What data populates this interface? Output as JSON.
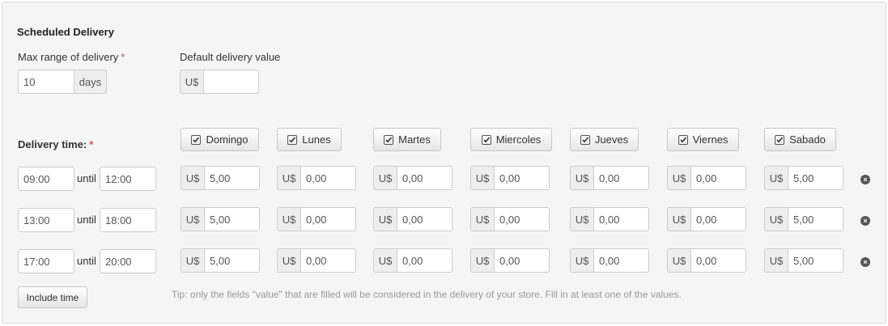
{
  "section_title": "Scheduled Delivery",
  "max_range": {
    "label": "Max range of delivery",
    "required": "*",
    "value": "10",
    "unit": "days"
  },
  "default_value": {
    "label": "Default delivery value",
    "currency": "U$",
    "value": ""
  },
  "delivery_time": {
    "label": "Delivery time:",
    "required": "*"
  },
  "days": [
    "Domingo",
    "Lunes",
    "Martes",
    "Miercoles",
    "Jueves",
    "Viernes",
    "Sabado"
  ],
  "currency": "U$",
  "until_label": "until",
  "rows": [
    {
      "from": "09:00",
      "to": "12:00",
      "values": [
        "5,00",
        "0,00",
        "0,00",
        "0,00",
        "0,00",
        "0,00",
        "5,00"
      ]
    },
    {
      "from": "13:00",
      "to": "18:00",
      "values": [
        "5,00",
        "0,00",
        "0,00",
        "0,00",
        "0,00",
        "0,00",
        "5,00"
      ]
    },
    {
      "from": "17:00",
      "to": "20:00",
      "values": [
        "5,00",
        "0,00",
        "0,00",
        "0,00",
        "0,00",
        "0,00",
        "5,00"
      ]
    }
  ],
  "include_button": "Include time",
  "tip": "Tip: only the fields \"value\" that are filled will be considered in the delivery of your store. Fill in at least one of the values.",
  "icons": {
    "checkbox": "checkbox-checked-icon",
    "remove": "remove-circle-icon"
  }
}
